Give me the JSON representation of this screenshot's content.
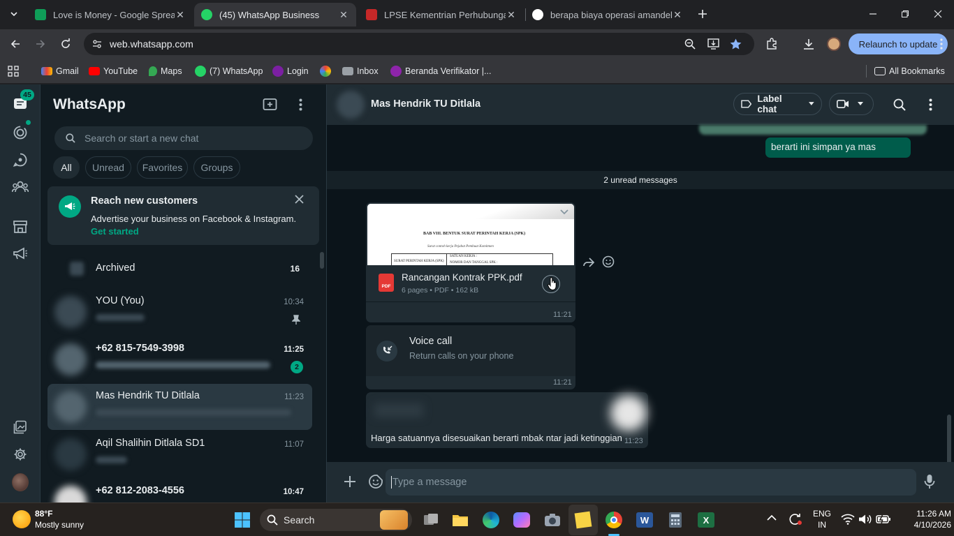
{
  "browser": {
    "tabs": [
      {
        "title": "Love is Money - Google Spread",
        "favicon_color": "#0f9d58",
        "active": false
      },
      {
        "title": "(45) WhatsApp Business",
        "favicon_color": "#25d366",
        "active": true
      },
      {
        "title": "LPSE Kementrian Perhubungan",
        "favicon_color": "#c62828",
        "active": false
      },
      {
        "title": "berapa biaya operasi amandel -",
        "favicon_color": "#ffffff",
        "active": false
      }
    ],
    "url": "web.whatsapp.com",
    "relaunch_label": "Relaunch to update",
    "bookmarks": [
      {
        "label": "Gmail"
      },
      {
        "label": "YouTube"
      },
      {
        "label": "Maps"
      },
      {
        "label": "(7) WhatsApp"
      },
      {
        "label": "Login"
      },
      {
        "label": ""
      },
      {
        "label": "Inbox"
      },
      {
        "label": "Beranda Verifikator |..."
      }
    ],
    "all_bookmarks_label": "All Bookmarks"
  },
  "nav": {
    "chats_badge": "45"
  },
  "sidebar": {
    "title": "WhatsApp",
    "search_placeholder": "Search or start a new chat",
    "filters": [
      "All",
      "Unread",
      "Favorites",
      "Groups"
    ],
    "promo": {
      "title": "Reach new customers",
      "body": "Advertise your business on Facebook & Instagram.",
      "link": "Get started"
    },
    "archived_label": "Archived",
    "archived_count": "16",
    "chats": [
      {
        "name": "YOU (You)",
        "time": "10:34",
        "unread": "",
        "pinned": true
      },
      {
        "name": "+62 815-7549-3998",
        "time": "11:25",
        "unread": "2",
        "pinned": false
      },
      {
        "name": "Mas Hendrik TU Ditlala",
        "time": "11:23",
        "unread": "",
        "pinned": false
      },
      {
        "name": "Aqil Shalihin Ditlala SD1",
        "time": "11:07",
        "unread": "",
        "pinned": false
      },
      {
        "name": "+62 812-2083-4556",
        "time": "10:47",
        "unread": "",
        "pinned": false
      }
    ]
  },
  "conversation": {
    "contact_name": "Mas Hendrik TU Ditlala",
    "label_chat": "Label chat",
    "outgoing_text": "berarti ini simpan ya mas",
    "unread_divider": "2 unread messages",
    "document": {
      "preview_heading": "BAB VIII. BENTUK SURAT PERINTAH KERJA (SPK)",
      "preview_sub": "Surat contoh kerja Pejabat Pembuat Komitmen",
      "preview_cell1": "SURAT PERINTAH KERJA (SPK)",
      "preview_cell2": "SATUAN KERJA :",
      "preview_cell3": "NOMOR DAN TANGGAL SPK :",
      "file_type": "PDF",
      "file_name": "Rancangan Kontrak PPK.pdf",
      "file_meta": "6 pages • PDF • 162 kB",
      "time": "11:21"
    },
    "voice_call": {
      "title": "Voice call",
      "subtitle": "Return calls on your phone",
      "time": "11:21"
    },
    "last_message": {
      "text": "Harga satuannya disesuaikan berarti mbak ntar jadi ketinggian",
      "time": "11:23"
    },
    "input_placeholder": "Type a message"
  },
  "taskbar": {
    "weather_temp": "88°F",
    "weather_desc": "Mostly sunny",
    "search_label": "Search",
    "lang_line1": "ENG",
    "lang_line2": "IN",
    "clock_time": "11:26 AM",
    "clock_date": "4/10/2026"
  }
}
